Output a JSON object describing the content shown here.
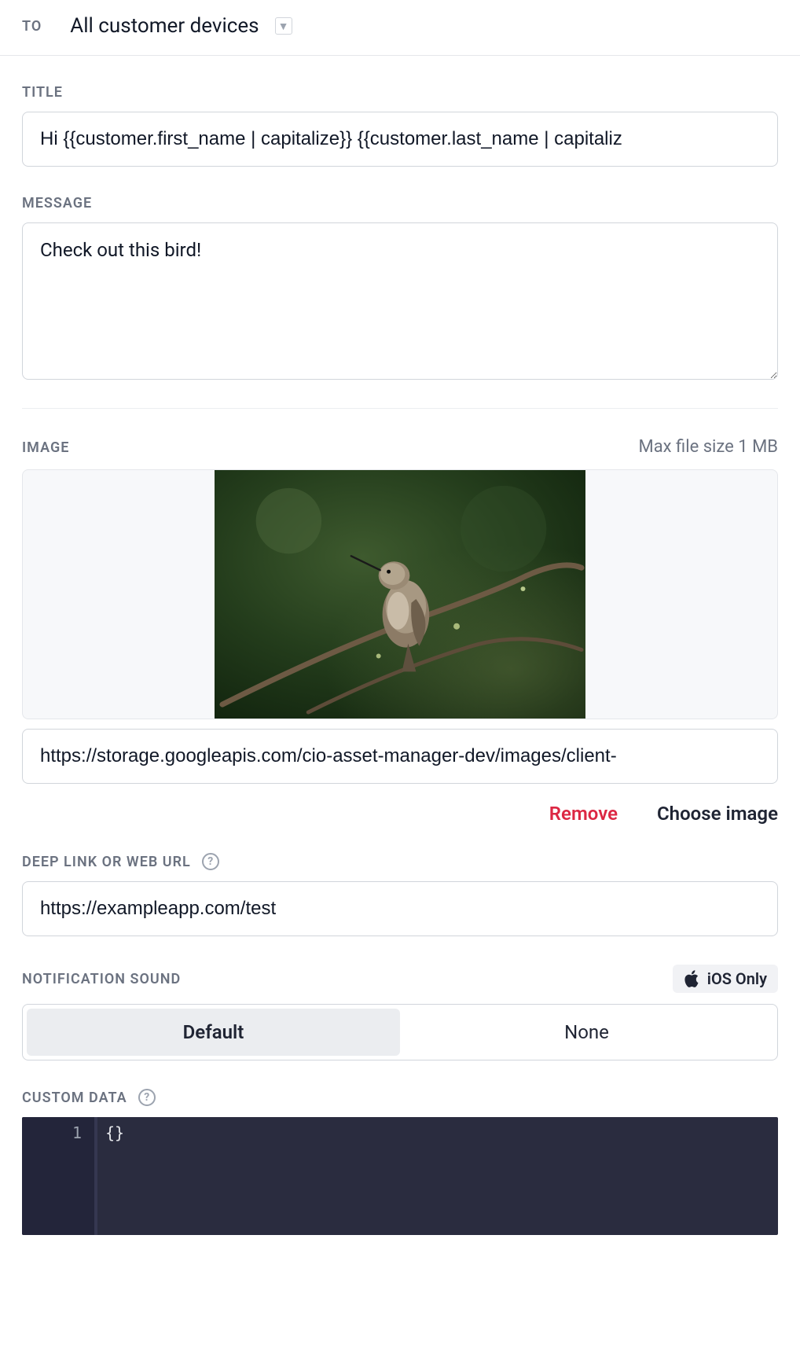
{
  "to": {
    "label": "TO",
    "selected": "All customer devices"
  },
  "title": {
    "label": "TITLE",
    "value": "Hi {{customer.first_name | capitalize}} {{customer.last_name | capitaliz"
  },
  "message": {
    "label": "MESSAGE",
    "value": "Check out this bird!"
  },
  "image": {
    "label": "IMAGE",
    "hint": "Max file size 1 MB",
    "url_value": "https://storage.googleapis.com/cio-asset-manager-dev/images/client-",
    "remove_label": "Remove",
    "choose_label": "Choose image"
  },
  "deep_link": {
    "label": "DEEP LINK OR WEB URL",
    "value": "https://exampleapp.com/test"
  },
  "sound": {
    "label": "NOTIFICATION SOUND",
    "ios_badge": "iOS Only",
    "option_default": "Default",
    "option_none": "None"
  },
  "custom_data": {
    "label": "CUSTOM DATA",
    "line_number": "1",
    "content": "{}"
  }
}
